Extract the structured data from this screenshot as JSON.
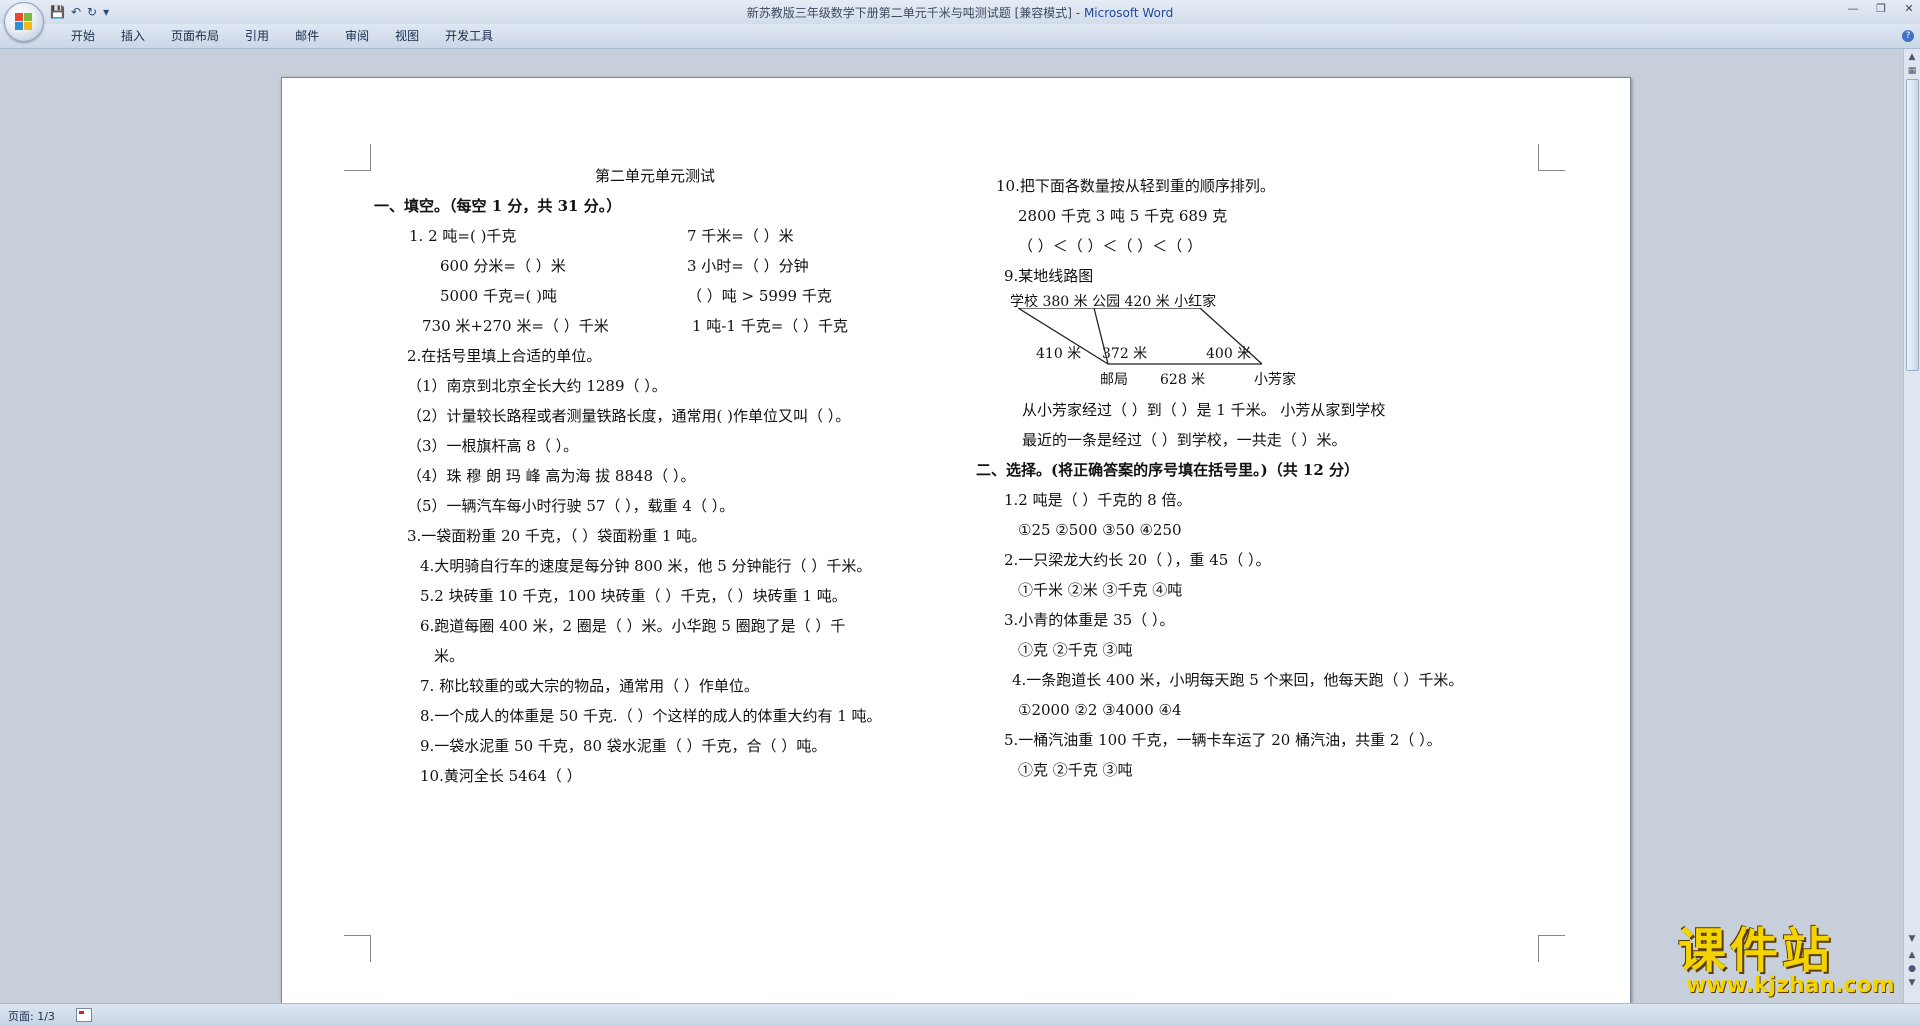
{
  "window": {
    "title": "新苏教版三年级数学下册第二单元千米与吨测试题 [兼容模式]",
    "title_sep": " - ",
    "app_name": "Microsoft Word"
  },
  "ribbon": {
    "tabs": [
      "开始",
      "插入",
      "页面布局",
      "引用",
      "邮件",
      "审阅",
      "视图",
      "开发工具"
    ]
  },
  "statusbar": {
    "page": "页面: 1/3"
  },
  "watermark": {
    "title": "课件站",
    "url": "www.kjzhan.com"
  },
  "colors": {
    "watermark": "#f4d400",
    "app_name": "#1e4a96",
    "ribbon_bg": "#dfe7f2"
  },
  "doc": {
    "left": [
      "第二单元单元测试",
      "一、填空。（每空 1 分，共 31 分。）",
      "1.   2 吨=(          )千克",
      "600 分米=（      ）米",
      "5000 千克=(        )吨",
      "730 米+270 米=（      ）千米",
      "2.在括号里填上合适的单位。",
      "（1）南京到北京全长大约 1289（      ）。",
      "（2）计量较长路程或者测量铁路长度，通常用(     )作单位又叫（      ）。",
      "（3）一根旗杆高 8（      ）。",
      "（4）珠 穆 朗 玛 峰 高为海 拔 8848（     ）。",
      "（5）一辆汽车每小时行驶 57（        ），载重 4（        ）。",
      "3.一袋面粉重 20 千克，（      ）袋面粉重 1 吨。",
      "4.大明骑自行车的速度是每分钟 800 米，他 5 分钟能行（          ）千米。",
      "5.2 块砖重 10 千克，100 块砖重（      ）千克，（      ）块砖重 1 吨。",
      "6.跑道每圈 400 米，2 圈是（       ）米。小华跑 5 圈跑了是（      ）千",
      "米。",
      "7. 称比较重的或大宗的物品，通常用（    ）作单位。",
      "8.一个成人的体重是 50 千克.（       ）个这样的成人的体重大约有 1 吨。",
      "9.一袋水泥重 50 千克，80 袋水泥重（      ）千克，合（    ）吨。",
      "10.黄河全长 5464（           ）"
    ],
    "left_col2": [
      "7 千米=（        ）米",
      "3 小时=（        ）分钟",
      "（       ）吨  > 5999 千克",
      "1 吨-1 千克=（     ）千克"
    ],
    "right": [
      "10.把下面各数量按从轻到重的顺序排列。",
      "2800 千克          3 吨          5 千克          689 克",
      "（         ）＜（         ）＜（         ）＜（         ）",
      "9.某地线路图",
      "从小芳家经过（          ）到（          ）是 1 千米。   小芳从家到学校",
      "最近的一条是经过（    ）到学校，一共走（      ）米。",
      "二、选择。(将正确答案的序号填在括号里。)（共 12 分）",
      "1.2 吨是（      ）千克的 8 倍。",
      "①25            ②500            ③50            ④250",
      "2.一只梁龙大约长 20（      ），重 45（      ）。",
      "①千米            ②米            ③千克            ④吨",
      "3.小青的体重是 35（      ）。",
      "①克            ②千克            ③吨",
      "4.一条跑道长 400 米，小明每天跑 5 个来回，他每天跑（       ）千米。",
      "①2000            ②2            ③4000            ④4",
      "5.一桶汽油重 100 千克，一辆卡车运了 20 桶汽油，共重 2（        ）。",
      "①克            ②千克            ③吨"
    ],
    "route": {
      "top": "学校  380 米  公园  420 米     小红家",
      "side_left": "410 米",
      "side_mid": "372 米",
      "side_right": "400 米",
      "bottom_left": "邮局",
      "bottom_mid": "628 米",
      "bottom_right": "小芳家"
    }
  }
}
